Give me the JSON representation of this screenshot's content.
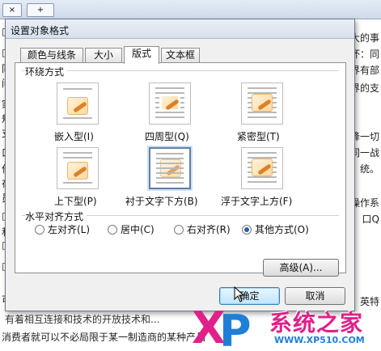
{
  "doc": {
    "tab_close": "×",
    "tab_add": "+",
    "lines_left": [
      "□",
      "□",
      "同",
      "间",
      "家",
      "规",
      "支持",
      "口",
      "任",
      "在",
      "员",
      "□",
      "和",
      "□",
      "□",
      "可",
      "下",
      "□"
    ],
    "lines_right": [
      "大的事",
      "坏：同",
      "界有部",
      "界的支",
      "",
      "降一切",
      "同一战",
      "统。",
      "",
      "操作系",
      "口Q",
      "",
      "",
      "",
      "",
      "英特"
    ],
    "bottom_line1": "有着相互连接和技术的开放技术和...",
    "bottom_line2": "消费者就可以不必局限于某一制造商的某种产品"
  },
  "dialog": {
    "title": "设置对象格式",
    "tabs": [
      "颜色与线条",
      "大小",
      "版式",
      "文本框"
    ],
    "active_tab": 2,
    "wrap_group_label": "环绕方式",
    "wrap_options": [
      {
        "label": "嵌入型(I)",
        "icon": "inline-with-text-icon"
      },
      {
        "label": "四周型(Q)",
        "icon": "square-wrap-icon"
      },
      {
        "label": "紧密型(T)",
        "icon": "tight-wrap-icon"
      },
      {
        "label": "上下型(P)",
        "icon": "top-bottom-wrap-icon"
      },
      {
        "label": "衬于文字下方(B)",
        "icon": "behind-text-icon"
      },
      {
        "label": "浮于文字上方(F)",
        "icon": "in-front-of-text-icon"
      }
    ],
    "selected_wrap": 4,
    "align_group_label": "水平对齐方式",
    "align_options": [
      "左对齐(L)",
      "居中(C)",
      "右对齐(R)",
      "其他方式(O)"
    ],
    "selected_align": 3,
    "advanced_button": "高级(A)...",
    "ok_button": "确定",
    "cancel_button": "取消"
  },
  "watermark": {
    "brand": "系统之家",
    "logo_letters": "XP",
    "url": "WWW.XP510.COM"
  },
  "colors": {
    "selection_border": "#5f7fa8",
    "radio_fill": "#2a5db0",
    "watermark_pink": "#e0218a",
    "watermark_blue": "#1e7fd8"
  }
}
